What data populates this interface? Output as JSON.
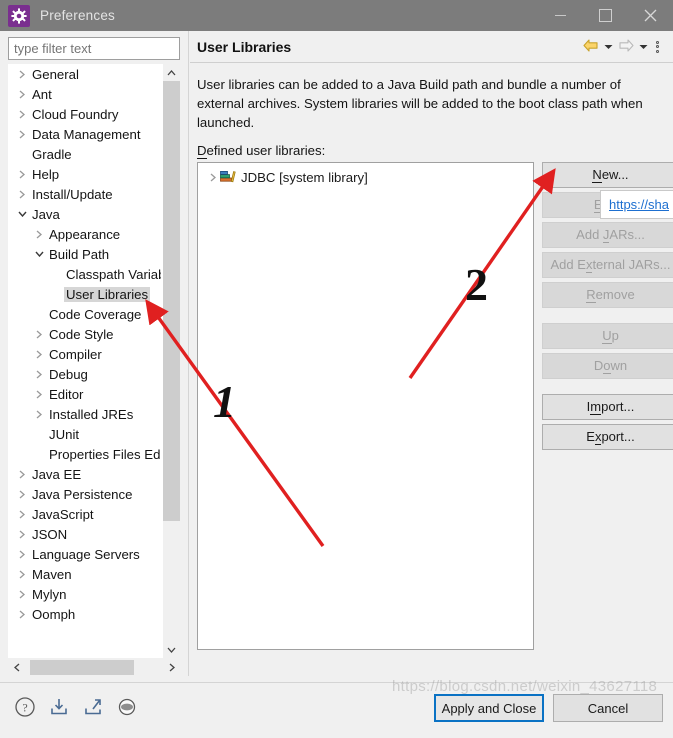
{
  "window": {
    "title": "Preferences",
    "app_icon": "gear-icon",
    "controls": {
      "minimize": "minimize-icon",
      "maximize": "maximize-icon",
      "close": "close-icon"
    }
  },
  "filter": {
    "placeholder": "type filter text",
    "value": ""
  },
  "tree": {
    "items": [
      {
        "label": "General",
        "indent": 0,
        "state": "collapsed"
      },
      {
        "label": "Ant",
        "indent": 0,
        "state": "collapsed"
      },
      {
        "label": "Cloud Foundry",
        "indent": 0,
        "state": "collapsed"
      },
      {
        "label": "Data Management",
        "indent": 0,
        "state": "collapsed"
      },
      {
        "label": "Gradle",
        "indent": 0,
        "state": "leaf"
      },
      {
        "label": "Help",
        "indent": 0,
        "state": "collapsed"
      },
      {
        "label": "Install/Update",
        "indent": 0,
        "state": "collapsed"
      },
      {
        "label": "Java",
        "indent": 0,
        "state": "expanded"
      },
      {
        "label": "Appearance",
        "indent": 1,
        "state": "collapsed"
      },
      {
        "label": "Build Path",
        "indent": 1,
        "state": "expanded"
      },
      {
        "label": "Classpath Variab",
        "indent": 2,
        "state": "leaf"
      },
      {
        "label": "User Libraries",
        "indent": 2,
        "state": "leaf",
        "selected": true
      },
      {
        "label": "Code Coverage",
        "indent": 1,
        "state": "leaf"
      },
      {
        "label": "Code Style",
        "indent": 1,
        "state": "collapsed"
      },
      {
        "label": "Compiler",
        "indent": 1,
        "state": "collapsed"
      },
      {
        "label": "Debug",
        "indent": 1,
        "state": "collapsed"
      },
      {
        "label": "Editor",
        "indent": 1,
        "state": "collapsed"
      },
      {
        "label": "Installed JREs",
        "indent": 1,
        "state": "collapsed"
      },
      {
        "label": "JUnit",
        "indent": 1,
        "state": "leaf"
      },
      {
        "label": "Properties Files Edi",
        "indent": 1,
        "state": "leaf"
      },
      {
        "label": "Java EE",
        "indent": 0,
        "state": "collapsed"
      },
      {
        "label": "Java Persistence",
        "indent": 0,
        "state": "collapsed"
      },
      {
        "label": "JavaScript",
        "indent": 0,
        "state": "collapsed"
      },
      {
        "label": "JSON",
        "indent": 0,
        "state": "collapsed"
      },
      {
        "label": "Language Servers",
        "indent": 0,
        "state": "collapsed"
      },
      {
        "label": "Maven",
        "indent": 0,
        "state": "collapsed"
      },
      {
        "label": "Mylyn",
        "indent": 0,
        "state": "collapsed"
      },
      {
        "label": "Oomph",
        "indent": 0,
        "state": "collapsed"
      }
    ]
  },
  "page": {
    "title": "User Libraries",
    "nav": {
      "back": "back-arrow-icon",
      "back_dropdown": "chevron-down-icon",
      "forward": "forward-arrow-icon",
      "forward_dropdown": "chevron-down-icon",
      "menu": "vertical-dots-icon"
    },
    "description": "User libraries can be added to a Java Build path and bundle a number of external archives. System libraries will be added to the boot class path when launched.",
    "defined_label_underlined": "D",
    "defined_label_rest": "efined user libraries:"
  },
  "libraries": {
    "rows": [
      {
        "label": "JDBC [system library]",
        "state": "collapsed",
        "icon": "library-books-icon"
      }
    ]
  },
  "buttons": {
    "new": {
      "pre": "",
      "accel": "N",
      "post": "ew...",
      "enabled": true
    },
    "edit": {
      "pre": "",
      "accel": "E",
      "post": "dit...",
      "enabled": false
    },
    "add_jars": {
      "pre": "Add ",
      "accel": "J",
      "post": "ARs...",
      "enabled": false
    },
    "add_external_jars": {
      "pre": "Add E",
      "accel": "x",
      "post": "ternal JARs...",
      "enabled": false
    },
    "remove": {
      "pre": "",
      "accel": "R",
      "post": "emove",
      "enabled": false
    },
    "up": {
      "pre": "",
      "accel": "U",
      "post": "p",
      "enabled": false
    },
    "down": {
      "pre": "D",
      "accel": "o",
      "post": "wn",
      "enabled": false
    },
    "import": {
      "pre": "I",
      "accel": "m",
      "post": "port...",
      "enabled": true
    },
    "export": {
      "pre": "E",
      "accel": "x",
      "post": "port...",
      "enabled": true
    }
  },
  "tooltip": {
    "link_text": "https://sha"
  },
  "bottom": {
    "icons": [
      {
        "name": "help-icon"
      },
      {
        "name": "import-preferences-icon"
      },
      {
        "name": "export-preferences-icon"
      },
      {
        "name": "restore-defaults-icon"
      }
    ],
    "apply_and_close": "Apply and Close",
    "cancel": "Cancel"
  },
  "watermark": {
    "text": "https://blog.csdn.net/weixin_43627118"
  },
  "annotations": {
    "one": "1",
    "two": "2",
    "color": "#e02020"
  }
}
